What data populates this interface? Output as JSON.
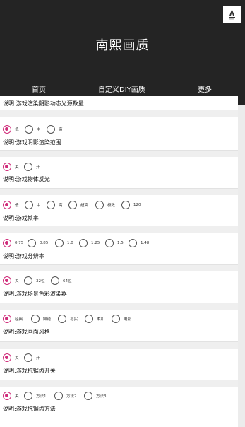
{
  "app": {
    "title": "南熙画质"
  },
  "tabs": [
    {
      "label": "首页"
    },
    {
      "label": "自定义DIY画质"
    },
    {
      "label": "更多"
    }
  ],
  "sections": [
    {
      "options": [],
      "description": "说明:游戏渲染阴影动态光源数量"
    },
    {
      "options": [
        {
          "label": "低",
          "checked": true
        },
        {
          "label": "中",
          "checked": false
        },
        {
          "label": "高",
          "checked": false
        }
      ],
      "description": "说明:游戏阴影渲染范围"
    },
    {
      "options": [
        {
          "label": "关",
          "checked": true
        },
        {
          "label": "开",
          "checked": false
        }
      ],
      "description": "说明:游戏物体反光"
    },
    {
      "options": [
        {
          "label": "低",
          "checked": true
        },
        {
          "label": "中",
          "checked": false
        },
        {
          "label": "高",
          "checked": false
        },
        {
          "label": "超高",
          "checked": false
        },
        {
          "label": "极致",
          "checked": false
        },
        {
          "label": "120",
          "checked": false
        }
      ],
      "description": "说明:游戏帧率"
    },
    {
      "options": [
        {
          "label": "0.75",
          "checked": true
        },
        {
          "label": "0.85",
          "checked": false
        },
        {
          "label": "1.0",
          "checked": false
        },
        {
          "label": "1.25",
          "checked": false
        },
        {
          "label": "1.5",
          "checked": false
        },
        {
          "label": "1.48",
          "checked": false
        }
      ],
      "description": "说明:游戏分辨率"
    },
    {
      "options": [
        {
          "label": "关",
          "checked": true
        },
        {
          "label": "32位",
          "checked": false
        },
        {
          "label": "64位",
          "checked": false
        }
      ],
      "description": "说明:游戏场景色彩渲染器"
    },
    {
      "options": [
        {
          "label": "经典",
          "checked": true
        },
        {
          "label": "鲜艳",
          "checked": false
        },
        {
          "label": "写实",
          "checked": false
        },
        {
          "label": "柔和",
          "checked": false
        },
        {
          "label": "电影",
          "checked": false
        }
      ],
      "description": "说明:游戏画面风格"
    },
    {
      "options": [
        {
          "label": "关",
          "checked": true
        },
        {
          "label": "开",
          "checked": false
        }
      ],
      "description": "说明:游戏抗锯齿开关"
    },
    {
      "options": [
        {
          "label": "关",
          "checked": true
        },
        {
          "label": "方法1",
          "checked": false
        },
        {
          "label": "方法2",
          "checked": false
        },
        {
          "label": "方法3",
          "checked": false
        }
      ],
      "description": "说明:游戏抗锯齿方法"
    }
  ],
  "colors": {
    "accent": "#d02c7a",
    "header_bg": "#242424"
  }
}
